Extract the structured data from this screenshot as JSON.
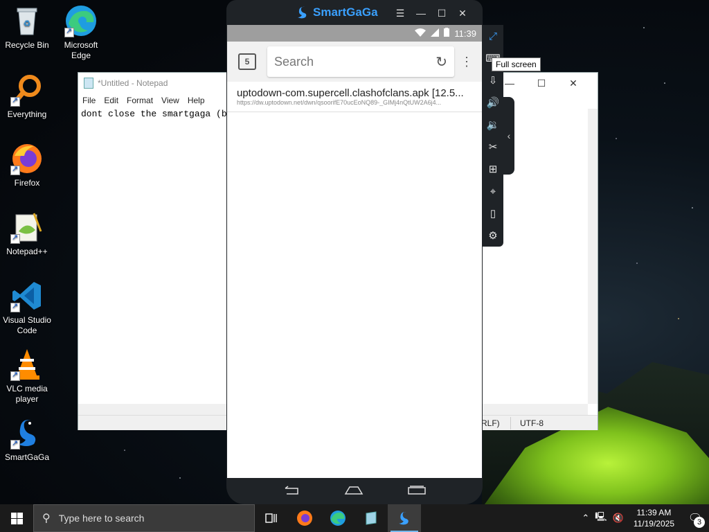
{
  "desktop": {
    "icons": [
      {
        "label": "Recycle Bin",
        "icon": "recycle-bin-icon"
      },
      {
        "label": "Microsoft Edge",
        "icon": "edge-icon"
      },
      {
        "label": "Everything",
        "icon": "everything-search-icon"
      },
      {
        "label": "Firefox",
        "icon": "firefox-icon"
      },
      {
        "label": "Notepad++",
        "icon": "notepad-plus-plus-icon"
      },
      {
        "label": "Visual Studio Code",
        "icon": "vscode-icon"
      },
      {
        "label": "VLC media player",
        "icon": "vlc-icon"
      },
      {
        "label": "SmartGaGa",
        "icon": "smartgaga-icon"
      }
    ]
  },
  "notepad": {
    "title": "*Untitled - Notepad",
    "menu": [
      "File",
      "Edit",
      "Format",
      "View",
      "Help"
    ],
    "text": "dont close the smartgaga (b",
    "status_crlf": "RLF)",
    "status_encoding": "UTF-8"
  },
  "smartgaga": {
    "brand": "SmartGaGa",
    "status_time": "11:39",
    "tab_count": "5",
    "search_placeholder": "Search",
    "download": {
      "title": "uptodown-com.supercell.clashofclans.apk [12.5...",
      "url": "https://dw.uptodown.net/dwn/qsoorifE70ucEoNQ89-_GIMj4nQtUW2A6j4..."
    },
    "tooltip": "Full screen",
    "colors": {
      "accent": "#3aa0ff",
      "frame": "#1f2327"
    }
  },
  "taskbar": {
    "search_placeholder": "Type here to search",
    "clock_time": "11:39 AM",
    "clock_date": "11/19/2025",
    "notification_count": "3"
  }
}
